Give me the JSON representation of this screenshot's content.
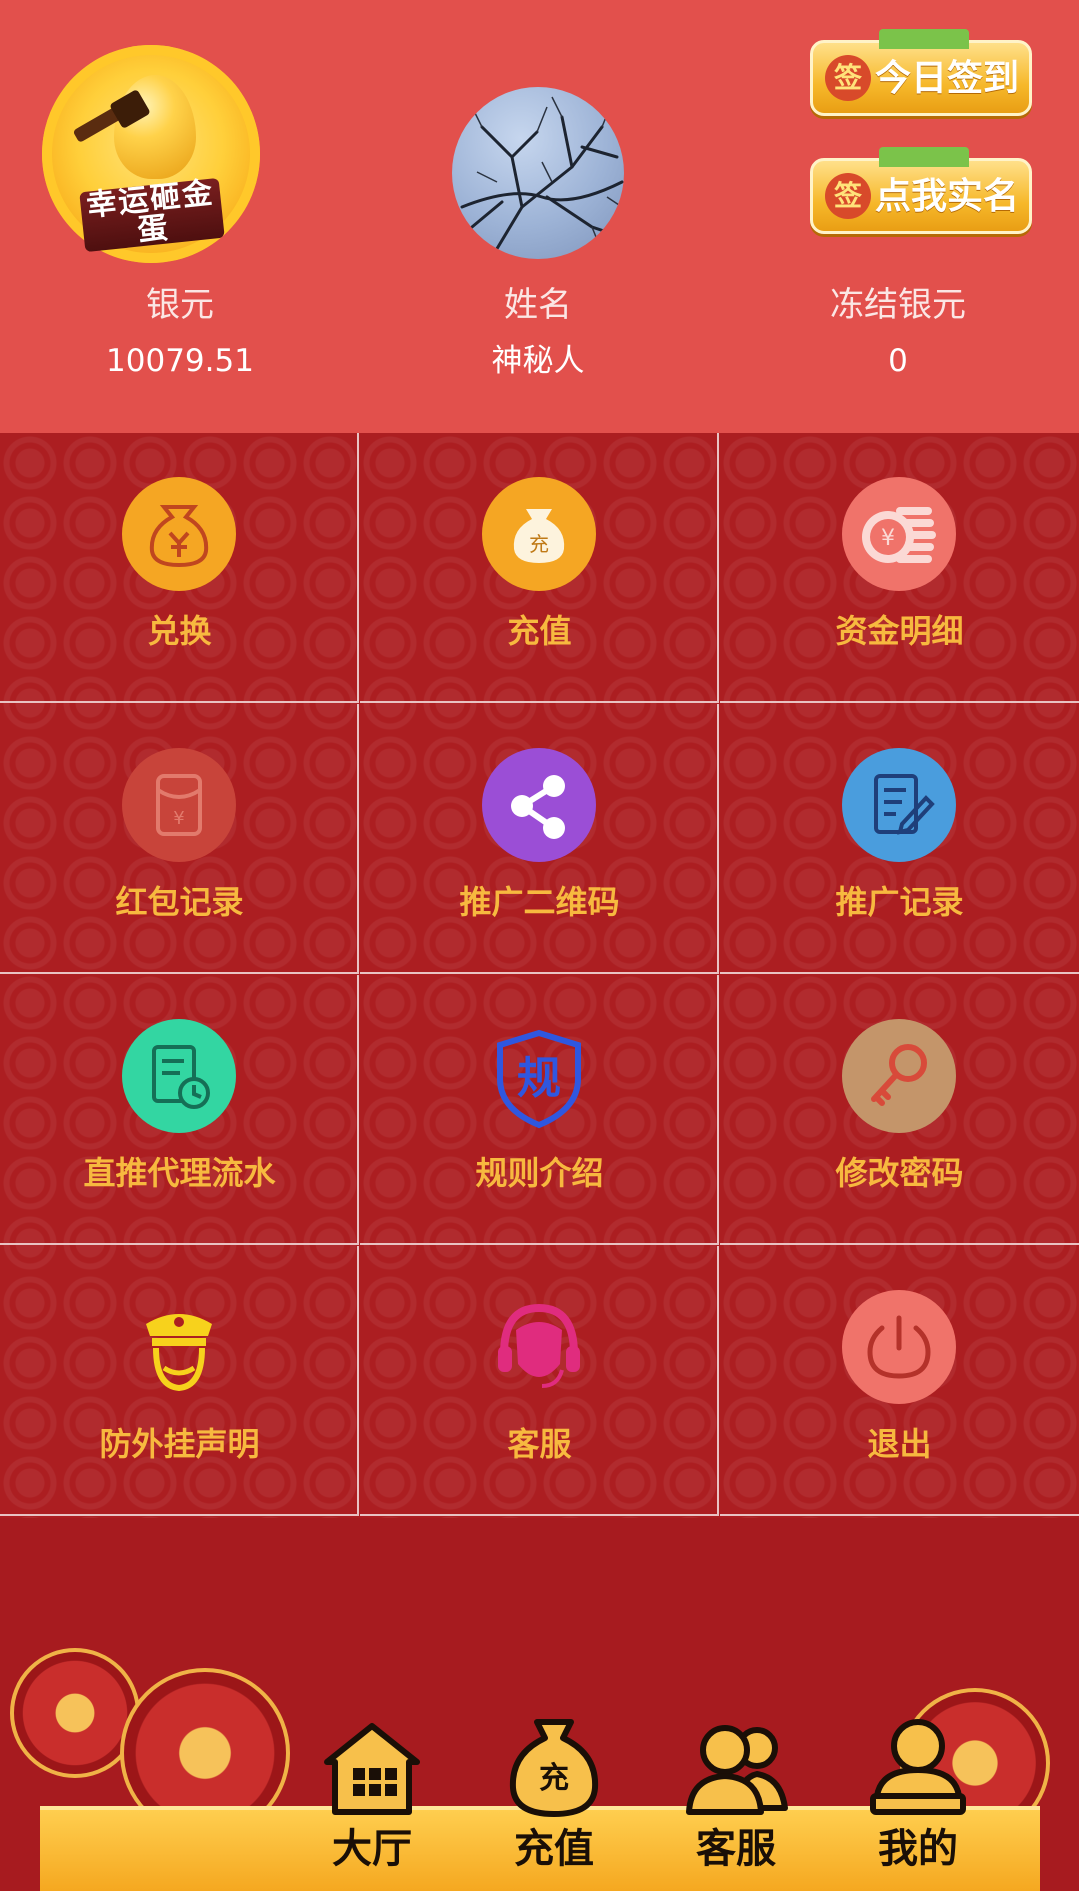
{
  "header": {
    "egg_logo": {
      "text": "幸运砸金蛋",
      "icon": "golden-egg-icon"
    },
    "avatar": {
      "icon": "tree-branches-photo"
    },
    "sign_in_button": {
      "seal": "签",
      "label": "今日签到"
    },
    "real_name_button": {
      "seal": "签",
      "label": "点我实名"
    },
    "stats": [
      {
        "label": "银元",
        "value": "10079.51"
      },
      {
        "label": "姓名",
        "value": "神秘人"
      },
      {
        "label": "冻结银元",
        "value": "0"
      }
    ]
  },
  "menu": [
    {
      "label": "兑换",
      "icon": "money-bag-yuan-icon",
      "color": "#f5a623"
    },
    {
      "label": "充值",
      "icon": "recharge-bag-icon",
      "color": "#f5a623"
    },
    {
      "label": "资金明细",
      "icon": "coins-stack-icon",
      "color": "#f0736a"
    },
    {
      "label": "红包记录",
      "icon": "red-envelope-icon",
      "color": "#c8443a"
    },
    {
      "label": "推广二维码",
      "icon": "share-icon",
      "color": "#9b4ed6"
    },
    {
      "label": "推广记录",
      "icon": "document-edit-icon",
      "color": "#4a9ddd"
    },
    {
      "label": "直推代理流水",
      "icon": "report-clock-icon",
      "color": "#33d6a2"
    },
    {
      "label": "规则介绍",
      "icon": "rules-shield-icon",
      "color": "#2f57e0",
      "glyph": "规"
    },
    {
      "label": "修改密码",
      "icon": "key-icon",
      "color": "#c4956a"
    },
    {
      "label": "防外挂声明",
      "icon": "police-icon",
      "color": "#f7d21c"
    },
    {
      "label": "客服",
      "icon": "headset-agent-icon",
      "color": "#e02c7e"
    },
    {
      "label": "退出",
      "icon": "power-icon",
      "color": "#f0736a"
    }
  ],
  "tabbar": [
    {
      "label": "大厅",
      "icon": "house-icon"
    },
    {
      "label": "充值",
      "icon": "recharge-bag-icon",
      "glyph": "充"
    },
    {
      "label": "客服",
      "icon": "users-icon"
    },
    {
      "label": "我的",
      "icon": "user-stamp-icon"
    }
  ],
  "colors": {
    "header_bg": "#e2504c",
    "grid_bg": "#ac1e21",
    "menu_label": "#f7b93f",
    "tabbar_bg": "#f5a820"
  }
}
